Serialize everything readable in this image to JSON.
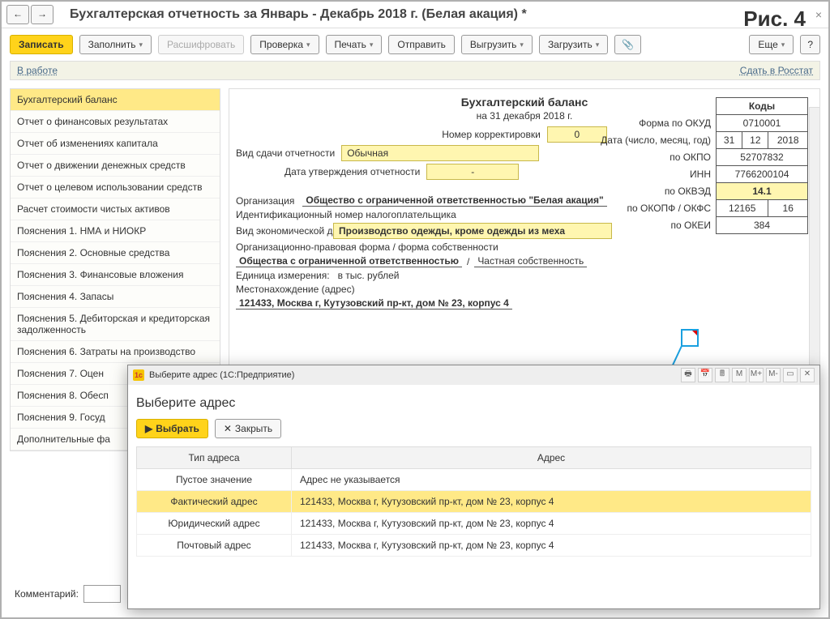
{
  "figure_label": "Рис. 4",
  "window_title": "Бухгалтерская отчетность за Январь - Декабрь 2018 г. (Белая акация) *",
  "toolbar": {
    "save": "Записать",
    "fill": "Заполнить",
    "decode": "Расшифровать",
    "check": "Проверка",
    "print": "Печать",
    "send": "Отправить",
    "upload": "Выгрузить",
    "download": "Загрузить",
    "more": "Еще"
  },
  "status": {
    "left": "В работе",
    "right": "Сдать в Росстат"
  },
  "sidebar": [
    "Бухгалтерский баланс",
    "Отчет о финансовых результатах",
    "Отчет об изменениях капитала",
    "Отчет о движении денежных средств",
    "Отчет о целевом использовании средств",
    "Расчет стоимости чистых активов",
    "Пояснения 1. НМА и НИОКР",
    "Пояснения 2. Основные средства",
    "Пояснения 3. Финансовые вложения",
    "Пояснения 4. Запасы",
    "Пояснения 5. Дебиторская и кредиторская задолженность",
    "Пояснения 6. Затраты на производство",
    "Пояснения 7. Оцен",
    "Пояснения 8. Обесп",
    "Пояснения 9. Госуд",
    "Дополнительные фа"
  ],
  "report": {
    "title": "Бухгалтерский баланс",
    "subtitle": "на 31 декабря 2018 г.",
    "corr_label": "Номер корректировки",
    "corr": "0",
    "mode_label": "Вид сдачи отчетности",
    "mode": "Обычная",
    "approve_label": "Дата утверждения отчетности",
    "approve": "-",
    "org_label": "Организация",
    "org": "Общество с ограниченной ответственностью \"Белая акация\"",
    "inn_label": "Идентификационный номер налогоплательщика",
    "act_label": "Вид экономической деятельности",
    "act": "Производство одежды, кроме одежды из меха",
    "opf_label": "Организационно-правовая форма / форма собственности",
    "opf1": "Общества с ограниченной ответственностью",
    "opf_sep": "/",
    "opf2": "Частная собственность",
    "unit_label": "Единица измерения:",
    "unit": "в тыс. рублей",
    "addr_label": "Местонахождение (адрес)",
    "addr": "121433, Москва г, Кутузовский пр-кт, дом № 23, корпус 4"
  },
  "codes": {
    "header": "Коды",
    "okud_l": "Форма по ОКУД",
    "okud": "0710001",
    "date_l": "Дата (число, месяц, год)",
    "d": "31",
    "m": "12",
    "y": "2018",
    "okpo_l": "по ОКПО",
    "okpo": "52707832",
    "inn_l": "ИНН",
    "inn": "7766200104",
    "okved_l": "по ОКВЭД",
    "okved": "14.1",
    "okopf_l": "по ОКОПФ / ОКФС",
    "okopf": "12165",
    "okfs": "16",
    "okei_l": "по ОКЕИ",
    "okei": "384"
  },
  "dialog": {
    "caption": "Выберите адрес  (1С:Предприятие)",
    "heading": "Выберите адрес",
    "select": "Выбрать",
    "close": "Закрыть",
    "col_type": "Тип адреса",
    "col_addr": "Адрес",
    "rows": [
      {
        "type": "Пустое значение",
        "addr": "Адрес не указывается"
      },
      {
        "type": "Фактический адрес",
        "addr": "121433, Москва г, Кутузовский пр-кт, дом № 23, корпус 4"
      },
      {
        "type": "Юридический адрес",
        "addr": "121433, Москва г, Кутузовский пр-кт, дом № 23, корпус 4"
      },
      {
        "type": "Почтовый адрес",
        "addr": "121433, Москва г, Кутузовский пр-кт, дом № 23, корпус 4"
      }
    ],
    "tb_icons": [
      "M",
      "M+",
      "M-"
    ]
  },
  "comment_label": "Комментарий:"
}
